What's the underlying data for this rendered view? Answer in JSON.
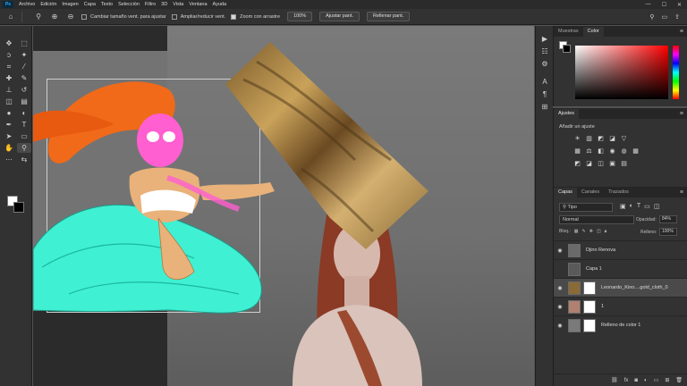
{
  "menubar": {
    "items": [
      "Archivo",
      "Edición",
      "Imagen",
      "Capa",
      "Texto",
      "Selección",
      "Filtro",
      "3D",
      "Vista",
      "Ventana",
      "Ayuda"
    ],
    "logo": "Ps"
  },
  "options": {
    "resize_windows_label": "Cambiar tamaño vent. para ajustar",
    "zoom_all_label": "Ampliar/reducir vent.",
    "scrubby_zoom_label": "Zoom con arrastre",
    "zoom_value": "100%",
    "fit_screen_label": "Ajustar pant.",
    "fill_screen_label": "Rellenar pant."
  },
  "panels": {
    "tabs_top": [
      "Muestras",
      "Color"
    ],
    "adjustments_tab": "Ajustes",
    "adjustments_hint": "Añadir un ajuste",
    "layers_tabs": [
      "Capas",
      "Canales",
      "Trazados"
    ],
    "filter_kind": "Tipo",
    "blend_mode": "Normal",
    "opacity_label": "Opacidad:",
    "opacity_value": "84%",
    "lock_label": "Bloq.:",
    "fill_label": "Relleno:",
    "fill_value": "100%"
  },
  "layers": [
    {
      "name": "Djinn Renova"
    },
    {
      "name": "Capa 1"
    },
    {
      "name": "Leonardo_Kino....gold_cloth_0"
    },
    {
      "name": "1"
    },
    {
      "name": "Relleno de color 1"
    }
  ],
  "colors": {
    "accent": "#31a8ff",
    "panel_bg": "#323232",
    "canvas_bg": "#2b2b2b"
  }
}
